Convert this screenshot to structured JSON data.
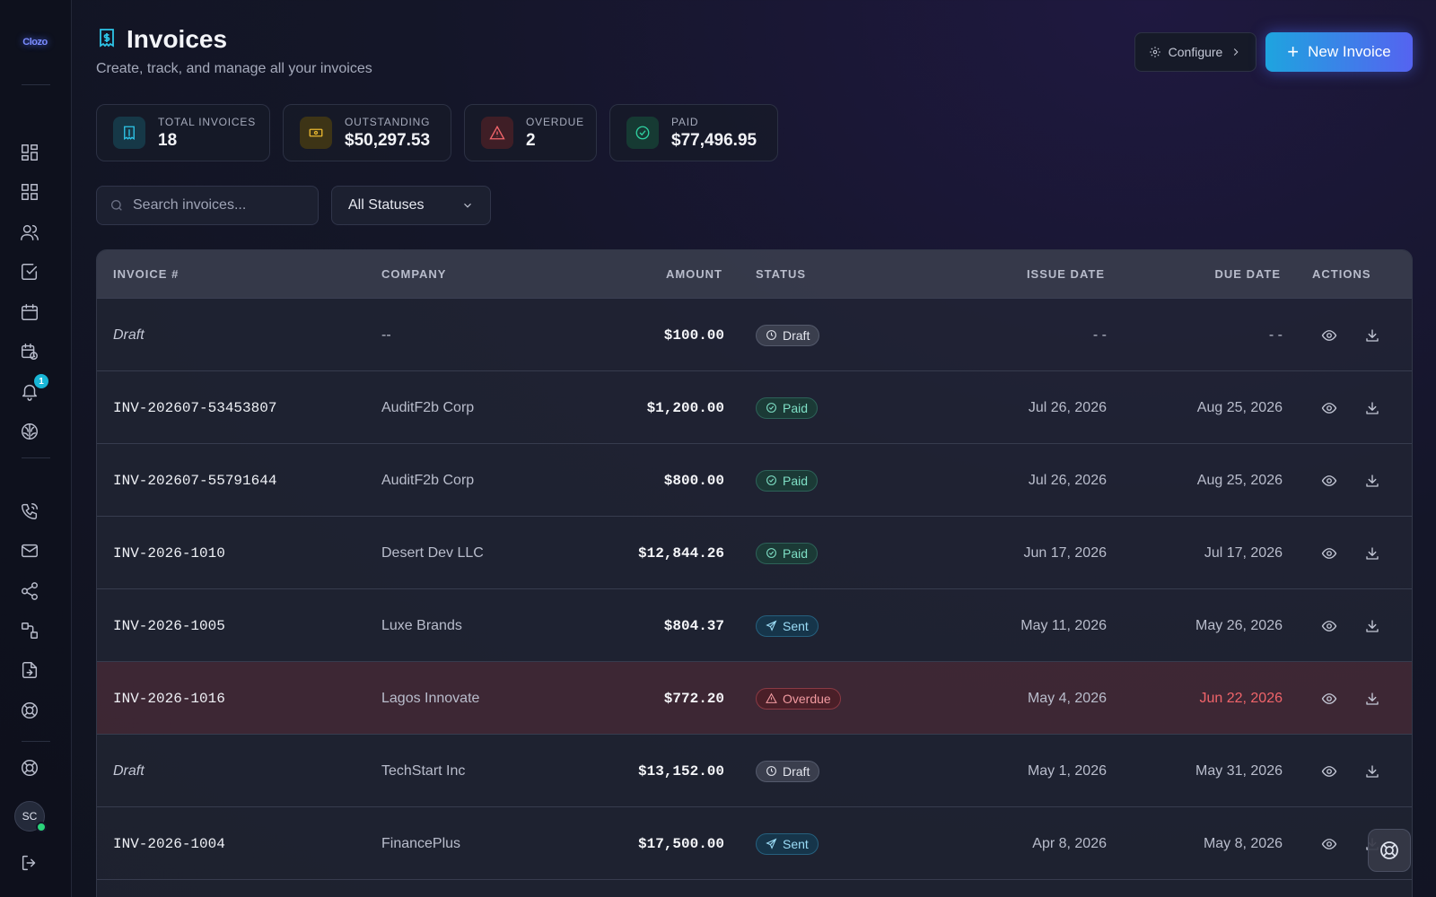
{
  "app": {
    "logo_text": "Clozo"
  },
  "header": {
    "title": "Invoices",
    "subtitle": "Create, track, and manage all your invoices",
    "configure_label": "Configure",
    "new_invoice_label": "New Invoice"
  },
  "sidebar": {
    "notification_count": "1",
    "avatar_initials": "SC",
    "items": [
      "dashboard-icon",
      "widgets-icon",
      "users-icon",
      "tasks-icon",
      "calendar-icon",
      "schedule-icon",
      "bell-icon",
      "brain-icon",
      "phone-icon",
      "mail-icon",
      "share-icon",
      "workflow-icon",
      "import-icon",
      "support-icon",
      "help-icon",
      "logout-icon"
    ]
  },
  "stats": [
    {
      "label": "TOTAL INVOICES",
      "value": "18",
      "icon": "invoice-icon",
      "color": "#2ec5e8"
    },
    {
      "label": "OUTSTANDING",
      "value": "$50,297.53",
      "icon": "cash-icon",
      "color": "#e8b730"
    },
    {
      "label": "OVERDUE",
      "value": "2",
      "icon": "warning-icon",
      "color": "#f0646a"
    },
    {
      "label": "PAID",
      "value": "$77,496.95",
      "icon": "check-circle-icon",
      "color": "#2fd0a0"
    }
  ],
  "filters": {
    "search_placeholder": "Search invoices...",
    "status_selected": "All Statuses"
  },
  "table": {
    "columns": [
      "INVOICE #",
      "COMPANY",
      "AMOUNT",
      "STATUS",
      "ISSUE DATE",
      "DUE DATE",
      "ACTIONS"
    ],
    "rows": [
      {
        "invoice": "Draft",
        "company": "--",
        "amount": "$100.00",
        "status": "Draft",
        "issue": "- -",
        "due": "- -"
      },
      {
        "invoice": "INV-202607-53453807",
        "company": "AuditF2b Corp",
        "amount": "$1,200.00",
        "status": "Paid",
        "issue": "Jul 26, 2026",
        "due": "Aug 25, 2026"
      },
      {
        "invoice": "INV-202607-55791644",
        "company": "AuditF2b Corp",
        "amount": "$800.00",
        "status": "Paid",
        "issue": "Jul 26, 2026",
        "due": "Aug 25, 2026"
      },
      {
        "invoice": "INV-2026-1010",
        "company": "Desert Dev LLC",
        "amount": "$12,844.26",
        "status": "Paid",
        "issue": "Jun 17, 2026",
        "due": "Jul 17, 2026"
      },
      {
        "invoice": "INV-2026-1005",
        "company": "Luxe Brands",
        "amount": "$804.37",
        "status": "Sent",
        "issue": "May 11, 2026",
        "due": "May 26, 2026"
      },
      {
        "invoice": "INV-2026-1016",
        "company": "Lagos Innovate",
        "amount": "$772.20",
        "status": "Overdue",
        "issue": "May 4, 2026",
        "due": "Jun 22, 2026"
      },
      {
        "invoice": "Draft",
        "company": "TechStart Inc",
        "amount": "$13,152.00",
        "status": "Draft",
        "issue": "May 1, 2026",
        "due": "May 31, 2026"
      },
      {
        "invoice": "INV-2026-1004",
        "company": "FinancePlus",
        "amount": "$17,500.00",
        "status": "Sent",
        "issue": "Apr 8, 2026",
        "due": "May 8, 2026"
      }
    ]
  },
  "colors": {
    "accent": "#2ec5e8",
    "brand_gradient_end": "#5563f0",
    "overdue": "#f0646a"
  }
}
